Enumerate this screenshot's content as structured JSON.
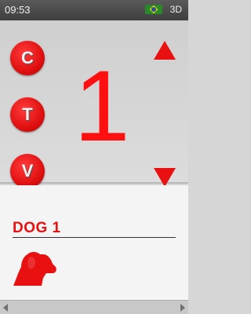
{
  "status_bar": {
    "time": "09:53",
    "mode": "3D"
  },
  "controls": {
    "buttons": [
      {
        "label": "C"
      },
      {
        "label": "T"
      },
      {
        "label": "V"
      }
    ],
    "current_value": "1"
  },
  "dog": {
    "name": "DOG 1"
  },
  "colors": {
    "accent": "#e81010",
    "status_bar": "#4a4a4a"
  },
  "icons": [
    "flag-icon",
    "arrow-up-icon",
    "arrow-down-icon",
    "dog-head-icon",
    "scroll-left-icon",
    "scroll-right-icon"
  ]
}
